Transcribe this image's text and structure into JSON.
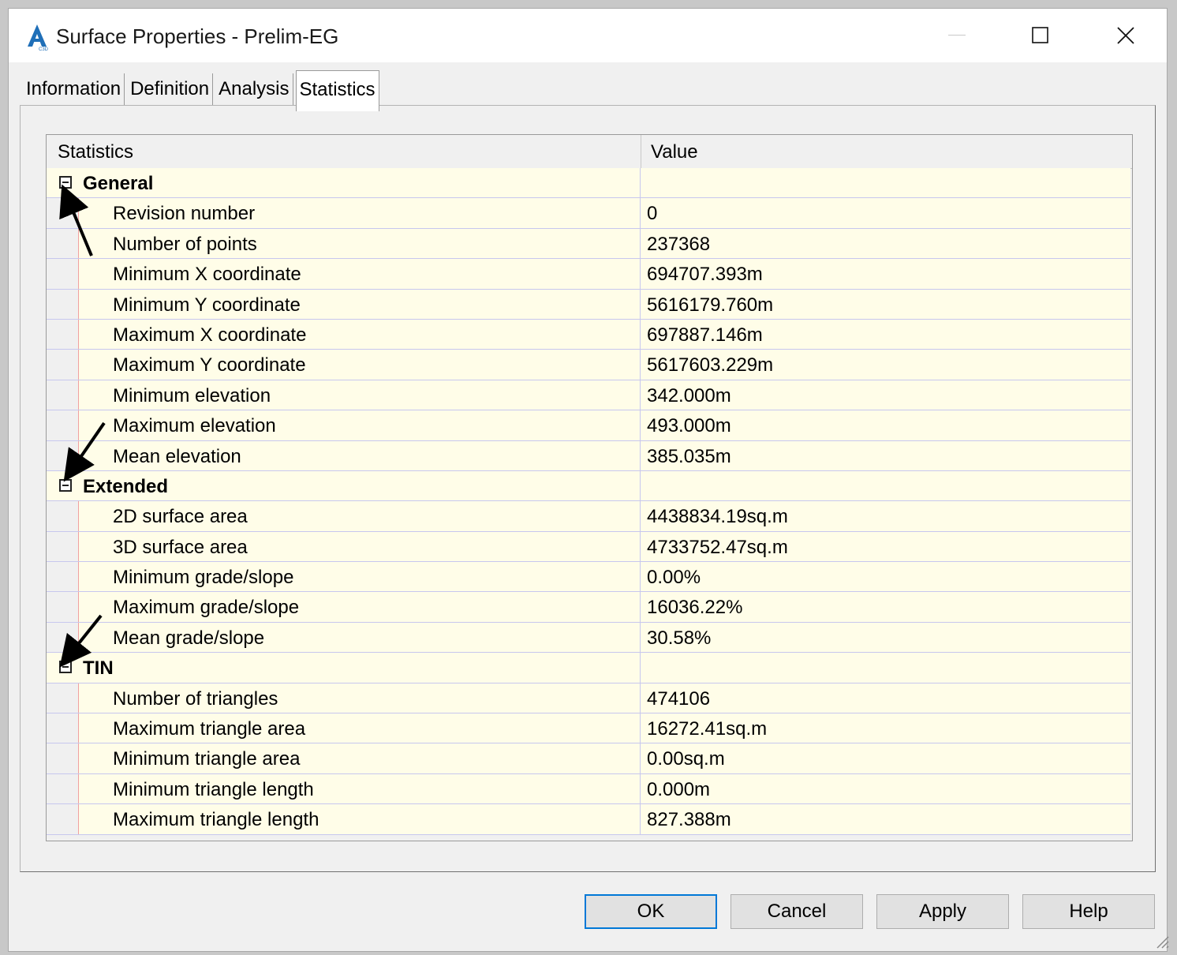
{
  "window": {
    "title": "Surface Properties - Prelim-EG",
    "app_icon": "autocad-civil3d-icon",
    "controls": [
      "minimize-icon",
      "maximize-icon",
      "close-icon"
    ]
  },
  "tabs": [
    {
      "label": "Information",
      "active": false
    },
    {
      "label": "Definition",
      "active": false
    },
    {
      "label": "Analysis",
      "active": false
    },
    {
      "label": "Statistics",
      "active": true
    }
  ],
  "grid": {
    "columns": [
      "Statistics",
      "Value"
    ],
    "groups": [
      {
        "name": "General",
        "rows": [
          {
            "name": "Revision number",
            "value": "0"
          },
          {
            "name": "Number of points",
            "value": "237368"
          },
          {
            "name": "Minimum X coordinate",
            "value": "694707.393m"
          },
          {
            "name": "Minimum Y coordinate",
            "value": "5616179.760m"
          },
          {
            "name": "Maximum X coordinate",
            "value": "697887.146m"
          },
          {
            "name": "Maximum Y coordinate",
            "value": "5617603.229m"
          },
          {
            "name": "Minimum elevation",
            "value": "342.000m"
          },
          {
            "name": "Maximum elevation",
            "value": "493.000m"
          },
          {
            "name": "Mean elevation",
            "value": "385.035m"
          }
        ]
      },
      {
        "name": "Extended",
        "rows": [
          {
            "name": "2D surface area",
            "value": "4438834.19sq.m"
          },
          {
            "name": "3D surface area",
            "value": "4733752.47sq.m"
          },
          {
            "name": "Minimum grade/slope",
            "value": "0.00%"
          },
          {
            "name": "Maximum grade/slope",
            "value": "16036.22%"
          },
          {
            "name": "Mean grade/slope",
            "value": "30.58%"
          }
        ]
      },
      {
        "name": "TIN",
        "rows": [
          {
            "name": "Number of triangles",
            "value": "474106"
          },
          {
            "name": "Maximum triangle area",
            "value": "16272.41sq.m"
          },
          {
            "name": "Minimum triangle area",
            "value": "0.00sq.m"
          },
          {
            "name": "Minimum triangle length",
            "value": "0.000m"
          },
          {
            "name": "Maximum triangle length",
            "value": "827.388m"
          }
        ]
      }
    ]
  },
  "buttons": {
    "ok": "OK",
    "cancel": "Cancel",
    "apply": "Apply",
    "help": "Help"
  },
  "colors": {
    "row_background": "#fffde8",
    "grid_line": "#c7c7ee",
    "default_button_border": "#0078d7"
  }
}
